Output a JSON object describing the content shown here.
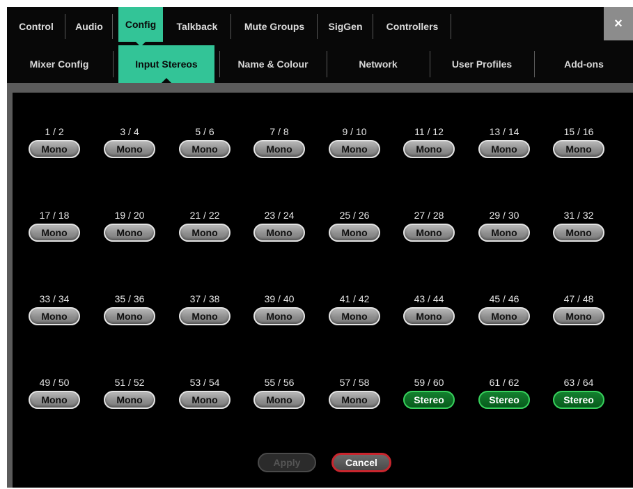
{
  "top_tabs": [
    {
      "label": "Control",
      "active": false
    },
    {
      "label": "Audio",
      "active": false
    },
    {
      "label": "Config",
      "active": true
    },
    {
      "label": "Talkback",
      "active": false
    },
    {
      "label": "Mute Groups",
      "active": false
    },
    {
      "label": "SigGen",
      "active": false
    },
    {
      "label": "Controllers",
      "active": false
    }
  ],
  "close_label": "×",
  "sub_tabs": [
    {
      "label": "Mixer Config",
      "active": false
    },
    {
      "label": "Input Stereos",
      "active": true
    },
    {
      "label": "Name & Colour",
      "active": false
    },
    {
      "label": "Network",
      "active": false
    },
    {
      "label": "User Profiles",
      "active": false
    },
    {
      "label": "Add-ons",
      "active": false
    }
  ],
  "channels": [
    {
      "label": "1 / 2",
      "mode": "Mono"
    },
    {
      "label": "3 / 4",
      "mode": "Mono"
    },
    {
      "label": "5 / 6",
      "mode": "Mono"
    },
    {
      "label": "7 / 8",
      "mode": "Mono"
    },
    {
      "label": "9 / 10",
      "mode": "Mono"
    },
    {
      "label": "11 / 12",
      "mode": "Mono"
    },
    {
      "label": "13 / 14",
      "mode": "Mono"
    },
    {
      "label": "15 / 16",
      "mode": "Mono"
    },
    {
      "label": "17 / 18",
      "mode": "Mono"
    },
    {
      "label": "19 / 20",
      "mode": "Mono"
    },
    {
      "label": "21 / 22",
      "mode": "Mono"
    },
    {
      "label": "23 / 24",
      "mode": "Mono"
    },
    {
      "label": "25 / 26",
      "mode": "Mono"
    },
    {
      "label": "27 / 28",
      "mode": "Mono"
    },
    {
      "label": "29 / 30",
      "mode": "Mono"
    },
    {
      "label": "31 / 32",
      "mode": "Mono"
    },
    {
      "label": "33 / 34",
      "mode": "Mono"
    },
    {
      "label": "35 / 36",
      "mode": "Mono"
    },
    {
      "label": "37 / 38",
      "mode": "Mono"
    },
    {
      "label": "39 / 40",
      "mode": "Mono"
    },
    {
      "label": "41 / 42",
      "mode": "Mono"
    },
    {
      "label": "43 / 44",
      "mode": "Mono"
    },
    {
      "label": "45 / 46",
      "mode": "Mono"
    },
    {
      "label": "47 / 48",
      "mode": "Mono"
    },
    {
      "label": "49 / 50",
      "mode": "Mono"
    },
    {
      "label": "51 / 52",
      "mode": "Mono"
    },
    {
      "label": "53 / 54",
      "mode": "Mono"
    },
    {
      "label": "55 / 56",
      "mode": "Mono"
    },
    {
      "label": "57 / 58",
      "mode": "Mono"
    },
    {
      "label": "59 / 60",
      "mode": "Stereo"
    },
    {
      "label": "61 / 62",
      "mode": "Stereo"
    },
    {
      "label": "63 / 64",
      "mode": "Stereo"
    }
  ],
  "actions": {
    "apply_label": "Apply",
    "cancel_label": "Cancel"
  },
  "colors": {
    "accent": "#33c497",
    "stereo": "#0a6b24",
    "stereo_border": "#37d15c",
    "cancel_border": "#c8262e",
    "panel_bg": "#000000"
  }
}
